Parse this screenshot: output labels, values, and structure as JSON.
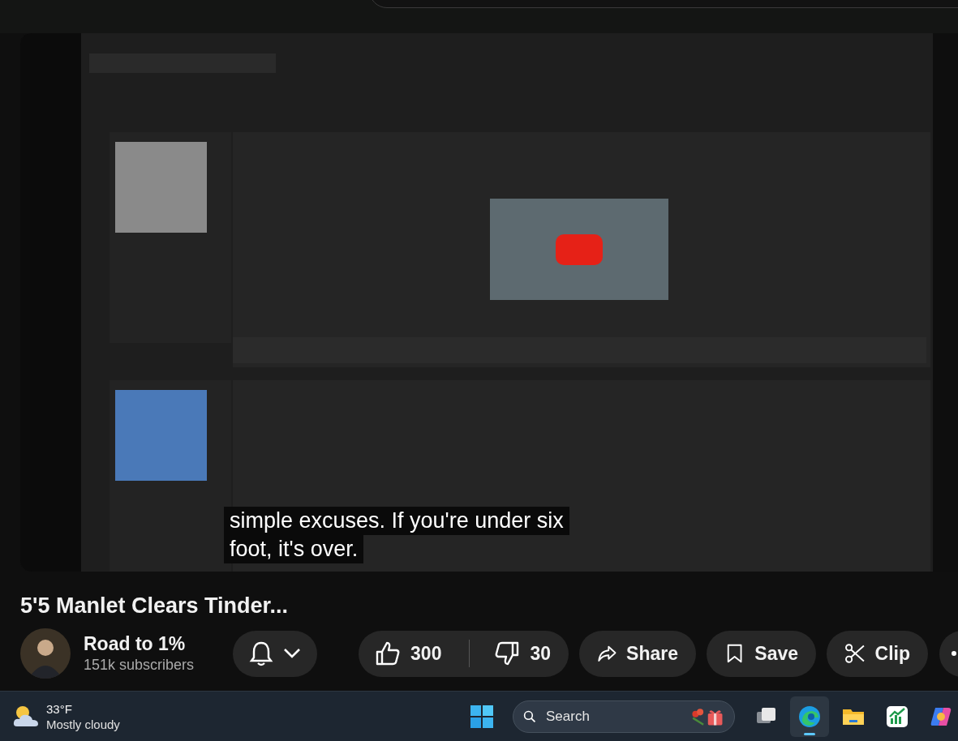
{
  "video": {
    "captions": [
      "simple excuses. If you're under six",
      "foot, it's over."
    ]
  },
  "title": "5'5 Manlet Clears Tinder...",
  "channel": {
    "name": "Road to 1%",
    "subscribers": "151k subscribers"
  },
  "actions": {
    "likes": "300",
    "dislikes": "30",
    "buttons": [
      {
        "kind": "share",
        "label": "Share"
      },
      {
        "kind": "save",
        "label": "Save"
      },
      {
        "kind": "clip",
        "label": "Clip"
      }
    ]
  },
  "taskbar": {
    "weather": {
      "temp": "33°F",
      "condition": "Mostly cloudy"
    },
    "search": {
      "placeholder": "Search"
    },
    "apps": [
      {
        "kind": "taskview",
        "active": false
      },
      {
        "kind": "edge",
        "active": true
      },
      {
        "kind": "files",
        "active": false
      },
      {
        "kind": "chart",
        "active": false
      },
      {
        "kind": "copilot",
        "active": false
      }
    ]
  }
}
